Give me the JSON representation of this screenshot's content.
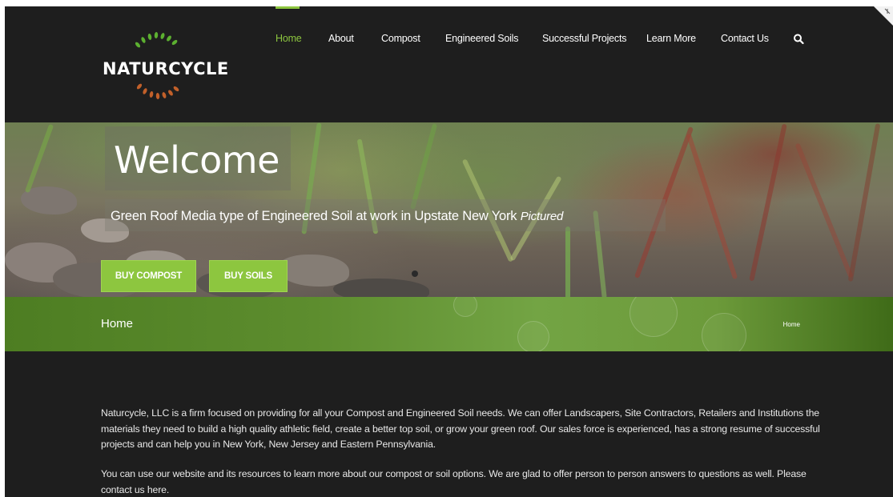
{
  "brand": {
    "logo_text": "NATURCYCLE"
  },
  "nav": {
    "items": [
      {
        "label": "Home",
        "active": true
      },
      {
        "label": "About",
        "active": false
      },
      {
        "label": "Compost",
        "active": false
      },
      {
        "label": "Engineered Soils",
        "active": false
      },
      {
        "label": "Successful Projects",
        "active": false
      },
      {
        "label": "Learn More",
        "active": false
      },
      {
        "label": "Contact Us",
        "active": false
      }
    ],
    "search_icon": "search-icon",
    "active_color": "#8dc63f"
  },
  "hero": {
    "title": "Welcome",
    "subtitle": "Green Roof Media type of Engineered Soil at work in Upstate New York",
    "subtitle_emphasis": "Pictured",
    "buttons": {
      "buy_compost": "BUY COMPOST",
      "buy_soils": "BUY SOILS"
    },
    "button_color": "#8dc63f"
  },
  "page_title_bar": {
    "title": "Home",
    "breadcrumb": "Home"
  },
  "content": {
    "paragraphs": [
      "Naturcycle, LLC is a firm focused on providing for all your Compost and Engineered Soil needs. We can offer Landscapers, Site Contractors, Retailers and Institutions the materials they need to build a high quality athletic field, create a better top soil, or grow your green roof. Our sales force is experienced, has a strong resume of successful projects and can help you in New York, New Jersey and Eastern Pennsylvania.",
      "You can use our website and its resources to learn more about our compost or soil options. We are glad to offer person to person answers to questions as well. Please contact us here."
    ]
  }
}
